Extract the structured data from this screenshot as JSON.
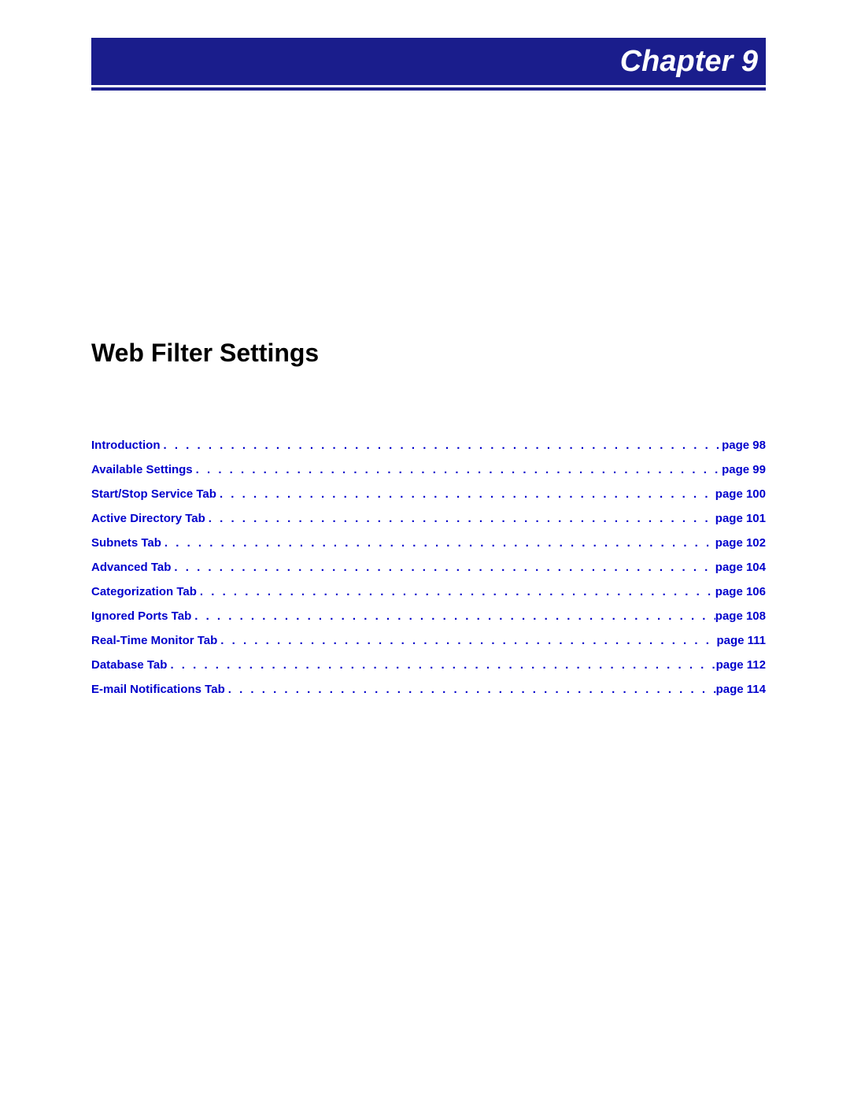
{
  "header": {
    "chapter_label": "Chapter 9"
  },
  "title": "Web Filter Settings",
  "toc": [
    {
      "label": "Introduction",
      "page": "page 98"
    },
    {
      "label": "Available Settings",
      "page": "page 99"
    },
    {
      "label": "Start/Stop Service Tab",
      "page": "page 100"
    },
    {
      "label": "Active Directory Tab",
      "page": "page 101"
    },
    {
      "label": "Subnets Tab",
      "page": "page 102"
    },
    {
      "label": "Advanced Tab",
      "page": "page 104"
    },
    {
      "label": "Categorization Tab",
      "page": "page 106"
    },
    {
      "label": "Ignored Ports Tab",
      "page": "page 108"
    },
    {
      "label": "Real-Time Monitor Tab",
      "page": "page 111"
    },
    {
      "label": "Database Tab",
      "page": "page 112"
    },
    {
      "label": "E-mail Notifications Tab",
      "page": "page 114"
    }
  ]
}
